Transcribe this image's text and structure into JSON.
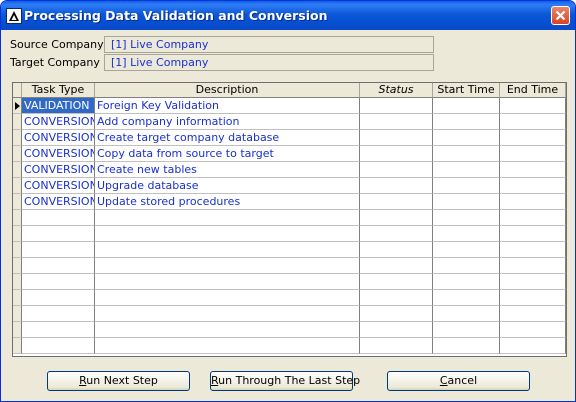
{
  "window": {
    "title": "Processing Data Validation and Conversion"
  },
  "source": {
    "label": "Source Company",
    "value": "[1] Live Company"
  },
  "target": {
    "label": "Target Company",
    "value": "[1] Live Company"
  },
  "grid": {
    "columns": [
      "Task Type",
      "Description",
      "Status",
      "Start Time",
      "End Time"
    ],
    "rows": [
      {
        "type": "VALIDATION",
        "description": "Foreign Key Validation",
        "status": "",
        "start": "",
        "end": ""
      },
      {
        "type": "CONVERSION",
        "description": "Add company information",
        "status": "",
        "start": "",
        "end": ""
      },
      {
        "type": "CONVERSION",
        "description": "Create target company database",
        "status": "",
        "start": "",
        "end": ""
      },
      {
        "type": "CONVERSION",
        "description": "Copy data from source to target",
        "status": "",
        "start": "",
        "end": ""
      },
      {
        "type": "CONVERSION",
        "description": "Create new tables",
        "status": "",
        "start": "",
        "end": ""
      },
      {
        "type": "CONVERSION",
        "description": "Upgrade database",
        "status": "",
        "start": "",
        "end": ""
      },
      {
        "type": "CONVERSION",
        "description": "Update stored procedures",
        "status": "",
        "start": "",
        "end": ""
      }
    ],
    "current_row_icon": "triangle-pointer-icon"
  },
  "buttons": {
    "run_next": "Run Next Step",
    "run_through": "Run Through The Last Step",
    "cancel": "Cancel"
  },
  "colors": {
    "value_text": "#1a2fd0",
    "selection": "#316ac5",
    "titlebar": "#0a4ac8"
  }
}
